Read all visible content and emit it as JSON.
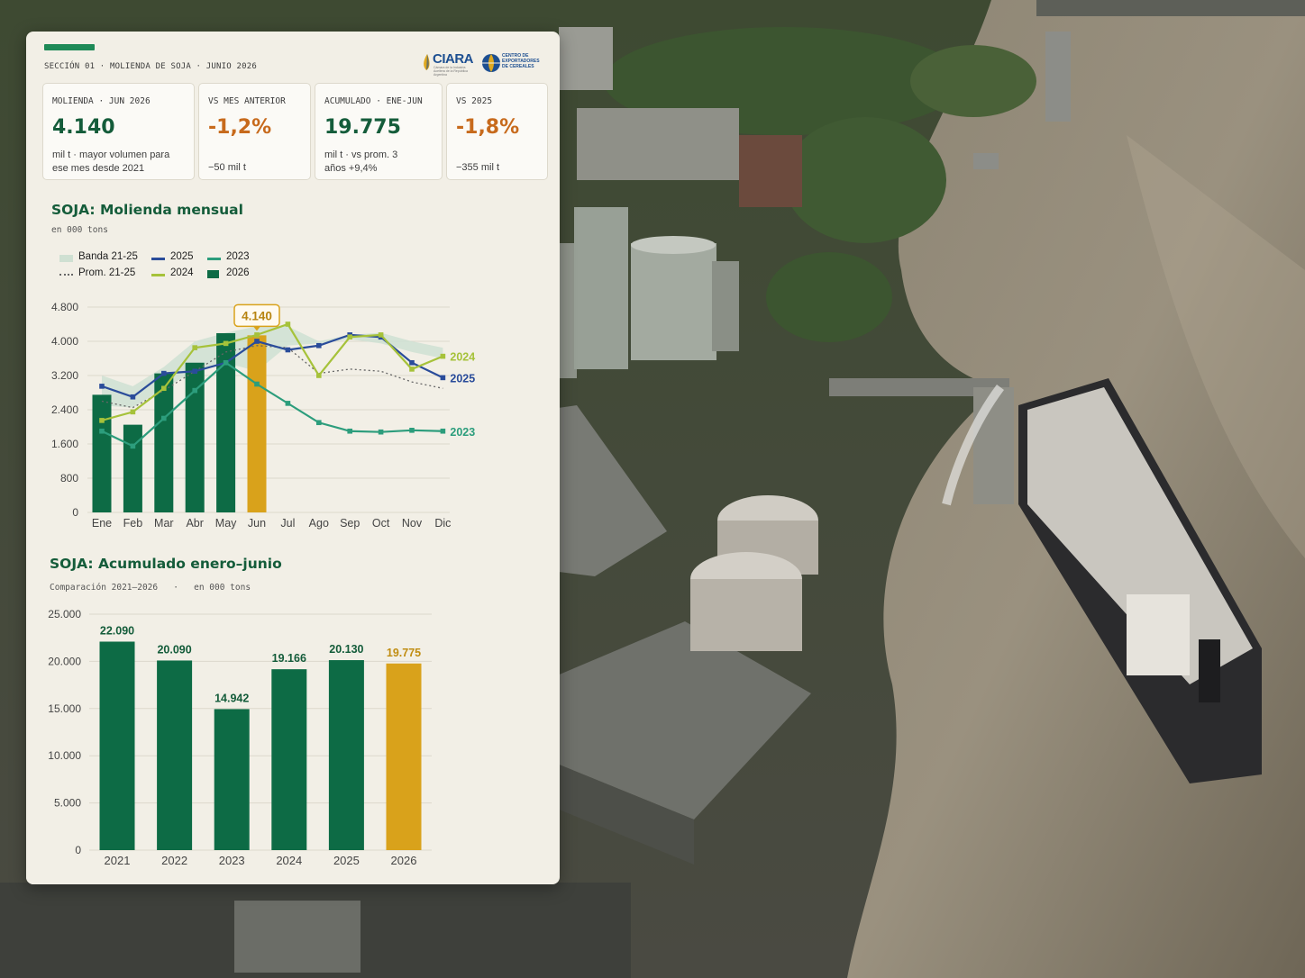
{
  "header": {
    "section_label": "SECCIÓN 01 · MOLIENDA DE SOJA · JUNIO 2026",
    "logo_ciara_text": "CIARA",
    "logo_ciara_sub": "Cámara de la Industria Aceitera de la República Argentina",
    "logo_cec_text": "CENTRO DE EXPORTADORES DE CEREALES"
  },
  "kpis": [
    {
      "label": "MOLIENDA · JUN 2026",
      "value": "4.140",
      "note": "mil t · mayor volumen para ese mes desde 2021",
      "tone": "green"
    },
    {
      "label": "VS MES ANTERIOR",
      "value": "-1,2%",
      "note": "−50 mil t",
      "tone": "orange"
    },
    {
      "label": "ACUMULADO · ENE-JUN",
      "value": "19.775",
      "note": "mil t · vs prom. 3 años +9,4%",
      "tone": "green"
    },
    {
      "label": "VS 2025",
      "value": "-1,8%",
      "note": "−355 mil t",
      "tone": "orange"
    }
  ],
  "colors": {
    "green_dark": "#0d6b45",
    "gold": "#d9a21b",
    "blue": "#2a4c9a",
    "lime": "#a6c23a",
    "teal": "#2c9d7c",
    "band": "#cfe0d2",
    "orange": "#c76a1c"
  },
  "chart_data": [
    {
      "type": "bar",
      "title": "SOJA: Molienda mensual",
      "subtitle": "en 000 tons",
      "categories": [
        "Ene",
        "Feb",
        "Mar",
        "Abr",
        "May",
        "Jun",
        "Jul",
        "Ago",
        "Sep",
        "Oct",
        "Nov",
        "Dic"
      ],
      "yticks": [
        "0",
        "800",
        "1.600",
        "2.400",
        "3.200",
        "4.000",
        "4.800"
      ],
      "ylim": [
        0,
        4800
      ],
      "legend": [
        {
          "label": "Banda 21-25",
          "kind": "band"
        },
        {
          "label": "2025",
          "kind": "line-blue"
        },
        {
          "label": "2023",
          "kind": "line-teal"
        },
        {
          "label": "Prom. 21-25",
          "kind": "dotted"
        },
        {
          "label": "2024",
          "kind": "line-lime"
        },
        {
          "label": "2026",
          "kind": "bar"
        }
      ],
      "highlight_label": "4.140",
      "series": [
        {
          "name": "2026",
          "kind": "bar",
          "values": [
            2750,
            2050,
            3250,
            3500,
            4190,
            4140
          ]
        },
        {
          "name": "Banda 21-25",
          "kind": "band",
          "low": [
            2500,
            2450,
            2900,
            3300,
            3500,
            3300,
            3900,
            3950,
            4050,
            3950,
            3750,
            3600
          ],
          "high": [
            3200,
            2950,
            3400,
            4000,
            4200,
            4350,
            4350,
            4000,
            4150,
            4200,
            4000,
            3850
          ]
        },
        {
          "name": "Prom. 21-25",
          "kind": "dotted",
          "values": [
            2600,
            2450,
            2850,
            3300,
            3750,
            3900,
            3850,
            3250,
            3350,
            3300,
            3050,
            2900
          ]
        },
        {
          "name": "2025",
          "kind": "line",
          "values": [
            2950,
            2700,
            3250,
            3300,
            3500,
            4000,
            3800,
            3900,
            4150,
            4100,
            3500,
            3150
          ]
        },
        {
          "name": "2024",
          "kind": "line",
          "values": [
            2150,
            2350,
            2900,
            3850,
            3950,
            4150,
            4400,
            3200,
            4100,
            4150,
            3350,
            3650
          ]
        },
        {
          "name": "2023",
          "kind": "line",
          "values": [
            1900,
            1550,
            2200,
            2850,
            3500,
            3000,
            2550,
            2100,
            1900,
            1880,
            1920,
            1900
          ]
        }
      ],
      "end_labels": [
        {
          "series": "2024",
          "label": "2024"
        },
        {
          "series": "2025",
          "label": "2025"
        },
        {
          "series": "2023",
          "label": "2023"
        }
      ]
    },
    {
      "type": "bar",
      "title": "SOJA: Acumulado enero–junio",
      "subtitle": "Comparación 2021–2026   ·   en 000 tons",
      "categories": [
        "2021",
        "2022",
        "2023",
        "2024",
        "2025",
        "2026"
      ],
      "values": [
        22090,
        20090,
        14942,
        19166,
        20130,
        19775
      ],
      "value_labels": [
        "22.090",
        "20.090",
        "14.942",
        "19.166",
        "20.130",
        "19.775"
      ],
      "yticks": [
        "0",
        "5.000",
        "10.000",
        "15.000",
        "20.000",
        "25.000"
      ],
      "ylim": [
        0,
        25000
      ]
    }
  ]
}
